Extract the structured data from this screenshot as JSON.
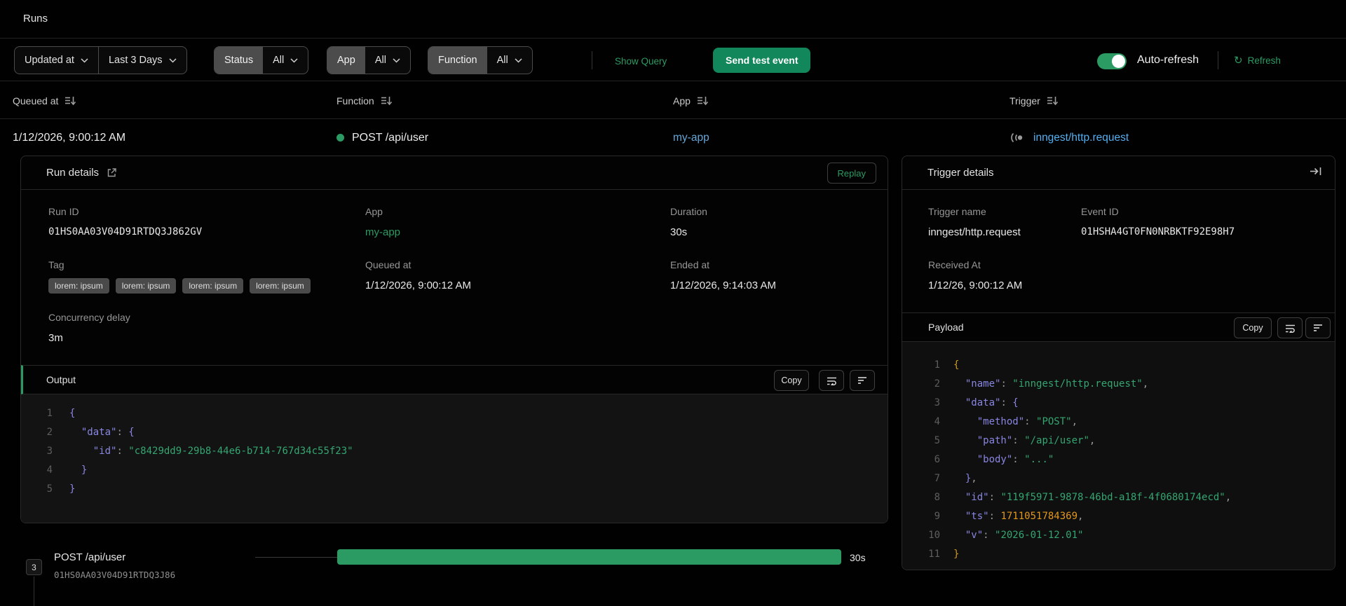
{
  "topbar": {
    "title": "Runs"
  },
  "filters": {
    "sort": {
      "label": "Updated at"
    },
    "range": {
      "label": "Last 3 Days"
    },
    "status": {
      "label": "Status",
      "value": "All"
    },
    "app": {
      "label": "App",
      "value": "All"
    },
    "function": {
      "label": "Function",
      "value": "All"
    },
    "show_query": "Show Query",
    "send_test_event": "Send test event",
    "auto_refresh": {
      "label": "Auto-refresh",
      "enabled": true
    },
    "refresh": "Refresh",
    "refresh_icon_glyph": "↻"
  },
  "table": {
    "columns": {
      "queued_at": "Queued at",
      "function": "Function",
      "app": "App",
      "trigger": "Trigger"
    },
    "row": {
      "queued_at": "1/12/2026, 9:00:12 AM",
      "function": "POST /api/user",
      "status": "completed",
      "app": "my-app",
      "trigger": "inngest/http.request"
    }
  },
  "run_details": {
    "title": "Run details",
    "replay": "Replay",
    "run_id": {
      "label": "Run ID",
      "value": "01HS0AA03V04D91RTDQ3J862GV"
    },
    "app": {
      "label": "App",
      "value": "my-app"
    },
    "duration": {
      "label": "Duration",
      "value": "30s"
    },
    "tag": {
      "label": "Tag",
      "tags": [
        "lorem: ipsum",
        "lorem: ipsum",
        "lorem: ipsum",
        "lorem: ipsum"
      ]
    },
    "queued_at": {
      "label": "Queued at",
      "value": "1/12/2026, 9:00:12 AM"
    },
    "ended_at": {
      "label": "Ended at",
      "value": "1/12/2026, 9:14:03 AM"
    },
    "concurrency_delay": {
      "label": "Concurrency delay",
      "value": "3m"
    },
    "output": {
      "title": "Output",
      "copy": "Copy",
      "lines": [
        [
          [
            "p",
            "{"
          ]
        ],
        [
          [
            "d",
            "  "
          ],
          [
            "k",
            "\"data\""
          ],
          [
            "d",
            ": "
          ],
          [
            "p",
            "{"
          ]
        ],
        [
          [
            "d",
            "    "
          ],
          [
            "k",
            "\"id\""
          ],
          [
            "d",
            ": "
          ],
          [
            "s",
            "\"c8429dd9-29b8-44e6-b714-767d34c55f23\""
          ]
        ],
        [
          [
            "d",
            "  "
          ],
          [
            "p",
            "}"
          ]
        ],
        [
          [
            "p",
            "}"
          ]
        ]
      ]
    }
  },
  "trigger_details": {
    "title": "Trigger details",
    "trigger_name": {
      "label": "Trigger name",
      "value": "inngest/http.request"
    },
    "event_id": {
      "label": "Event ID",
      "value": "01HSHA4GT0FN0NRBKTF92E98H7"
    },
    "received_at": {
      "label": "Received At",
      "value": "1/12/26, 9:00:12 AM"
    },
    "payload": {
      "title": "Payload",
      "copy": "Copy",
      "lines": [
        [
          [
            "o",
            "{"
          ]
        ],
        [
          [
            "d",
            "  "
          ],
          [
            "k",
            "\"name\""
          ],
          [
            "d",
            ": "
          ],
          [
            "s",
            "\"inngest/http.request\""
          ],
          [
            "d",
            ","
          ]
        ],
        [
          [
            "d",
            "  "
          ],
          [
            "k",
            "\"data\""
          ],
          [
            "d",
            ": "
          ],
          [
            "p",
            "{"
          ]
        ],
        [
          [
            "d",
            "    "
          ],
          [
            "k",
            "\"method\""
          ],
          [
            "d",
            ": "
          ],
          [
            "s",
            "\"POST\""
          ],
          [
            "d",
            ","
          ]
        ],
        [
          [
            "d",
            "    "
          ],
          [
            "k",
            "\"path\""
          ],
          [
            "d",
            ": "
          ],
          [
            "s",
            "\"/api/user\""
          ],
          [
            "d",
            ","
          ]
        ],
        [
          [
            "d",
            "    "
          ],
          [
            "k",
            "\"body\""
          ],
          [
            "d",
            ": "
          ],
          [
            "s",
            "\"...\""
          ]
        ],
        [
          [
            "d",
            "  "
          ],
          [
            "p",
            "}"
          ],
          [
            "d",
            ","
          ]
        ],
        [
          [
            "d",
            "  "
          ],
          [
            "k",
            "\"id\""
          ],
          [
            "d",
            ": "
          ],
          [
            "s",
            "\"119f5971-9878-46bd-a18f-4f0680174ecd\""
          ],
          [
            "d",
            ","
          ]
        ],
        [
          [
            "d",
            "  "
          ],
          [
            "k",
            "\"ts\""
          ],
          [
            "d",
            ": "
          ],
          [
            "n",
            "1711051784369"
          ],
          [
            "d",
            ","
          ]
        ],
        [
          [
            "d",
            "  "
          ],
          [
            "k",
            "\"v\""
          ],
          [
            "d",
            ": "
          ],
          [
            "s",
            "\"2026-01-12.01\""
          ]
        ],
        [
          [
            "o",
            "}"
          ]
        ]
      ]
    }
  },
  "timeline": {
    "badge": "3",
    "step_name": "POST /api/user",
    "step_id": "01HS0AA03V04D91RTDQ3J86",
    "duration": "30s"
  },
  "colors": {
    "accent_green": "#2c9b63",
    "button_green": "#12875b",
    "app_link_blue": "#64a7d9",
    "trigger_link_blue": "#54aff0",
    "status_dot_green": "#2c9b63",
    "code_key_purple": "#8986e2",
    "code_string_green": "#35a571",
    "code_number_orange": "#e2981c"
  }
}
